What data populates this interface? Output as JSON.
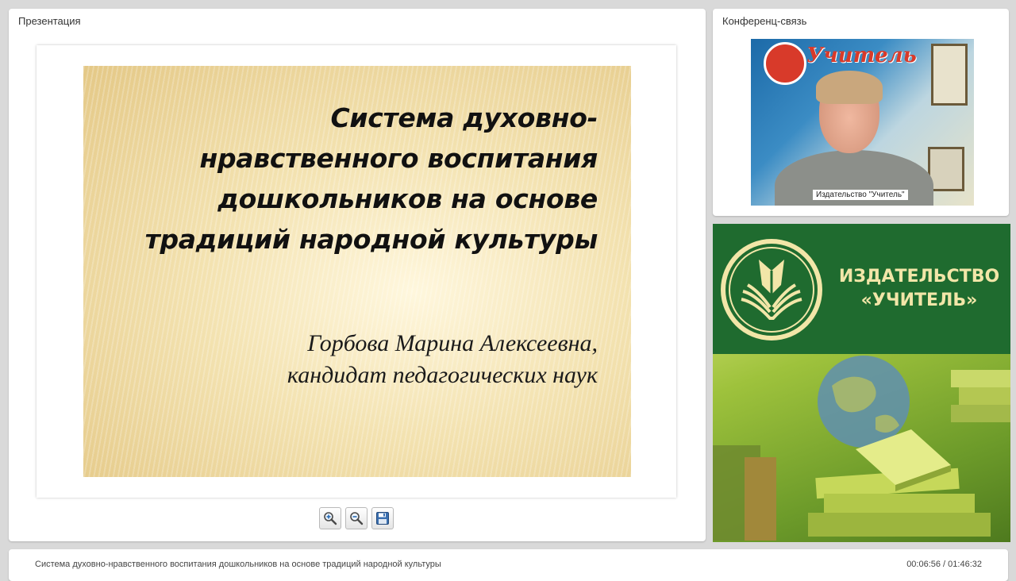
{
  "presentation": {
    "panel_title": "Презентация",
    "slide": {
      "title": "Система духовно-нравственного воспитания дошкольников на основе традиций народной культуры",
      "author_name": "Горбова Марина Алексеевна,",
      "author_degree": "кандидат педагогических наук"
    },
    "toolbar": {
      "zoom_in_icon": "zoom-in-icon",
      "zoom_out_icon": "zoom-out-icon",
      "save_icon": "floppy-disk-icon"
    }
  },
  "conference": {
    "panel_title": "Конференц-связь",
    "video_label": "Издательство \"Учитель\"",
    "banner_text": "Учитель"
  },
  "publisher": {
    "line1": "ИЗДАТЕЛЬСТВО",
    "line2": "«УЧИТЕЛЬ»"
  },
  "footer": {
    "title": "Система духовно-нравственного воспитания дошкольников на основе традиций народной культуры",
    "time": "00:06:56 / 01:46:32"
  },
  "colors": {
    "background": "#d9d9d9",
    "publisher_green": "#1f6b2f",
    "publisher_gold": "#f2e6a8",
    "slide_gold": "#e4c886"
  }
}
